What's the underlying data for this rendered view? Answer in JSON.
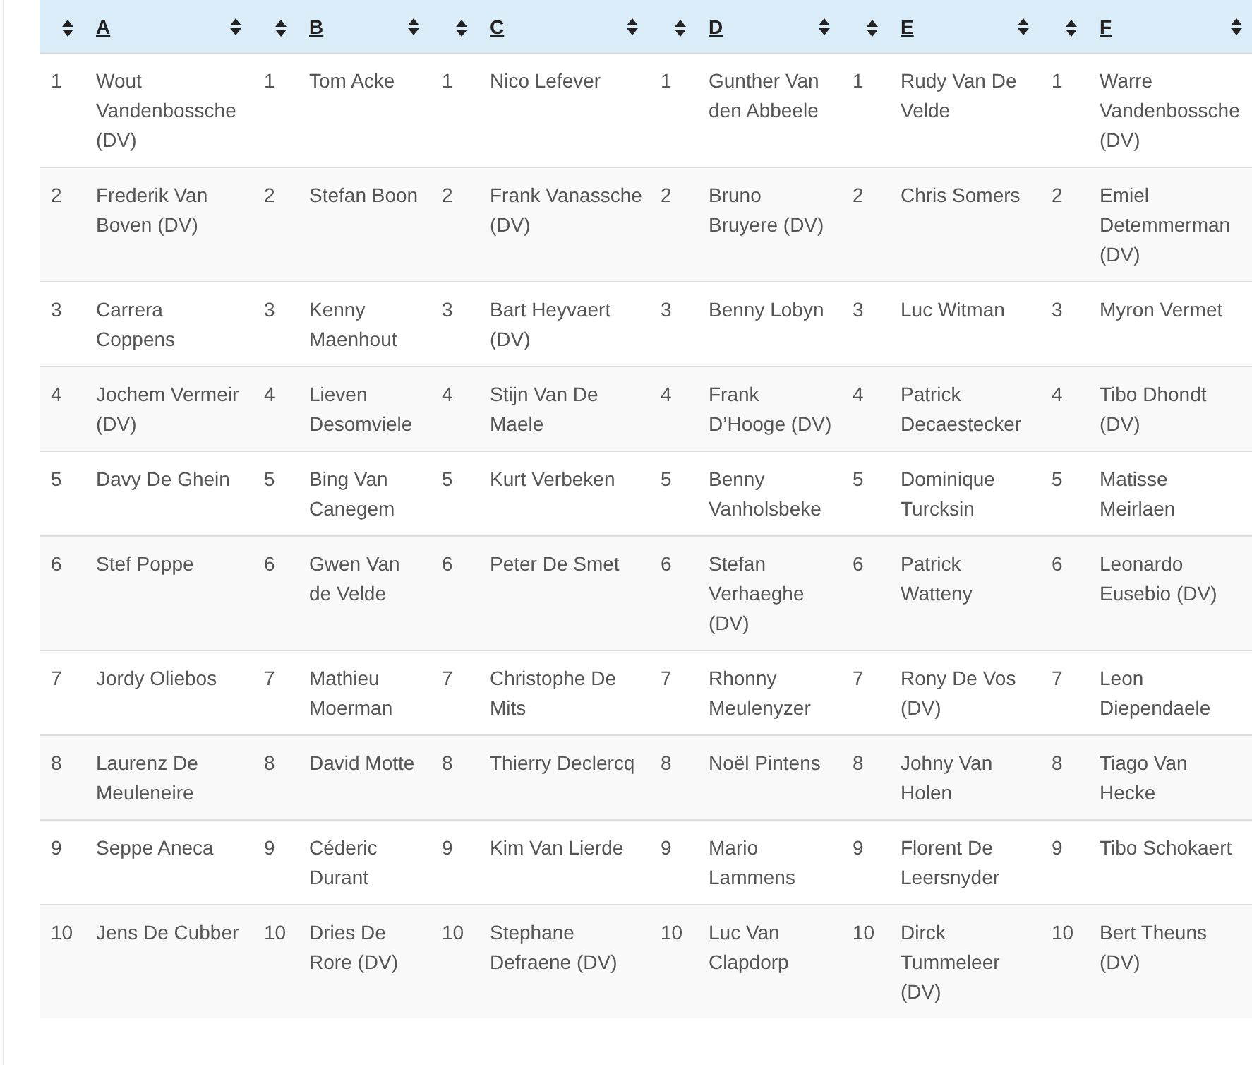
{
  "table": {
    "columns": [
      {
        "label": "A"
      },
      {
        "label": "B"
      },
      {
        "label": "C"
      },
      {
        "label": "D"
      },
      {
        "label": "E"
      },
      {
        "label": "F"
      }
    ],
    "rows": [
      {
        "cells": [
          {
            "number": "1",
            "name": "Wout Vandenbossche (DV)"
          },
          {
            "number": "1",
            "name": "Tom Acke"
          },
          {
            "number": "1",
            "name": "Nico Lefever"
          },
          {
            "number": "1",
            "name": "Gunther Van den Abbeele"
          },
          {
            "number": "1",
            "name": "Rudy Van De Velde"
          },
          {
            "number": "1",
            "name": "Warre Vandenbossche (DV)"
          }
        ]
      },
      {
        "cells": [
          {
            "number": "2",
            "name": "Frederik Van Boven (DV)"
          },
          {
            "number": "2",
            "name": "Stefan Boon"
          },
          {
            "number": "2",
            "name": "Frank Vanassche (DV)"
          },
          {
            "number": "2",
            "name": "Bruno Bruyere (DV)"
          },
          {
            "number": "2",
            "name": "Chris Somers"
          },
          {
            "number": "2",
            "name": "Emiel Detemmerman (DV)"
          }
        ]
      },
      {
        "cells": [
          {
            "number": "3",
            "name": "Carrera Coppens"
          },
          {
            "number": "3",
            "name": "Kenny Maenhout"
          },
          {
            "number": "3",
            "name": "Bart Heyvaert (DV)"
          },
          {
            "number": "3",
            "name": "Benny Lobyn"
          },
          {
            "number": "3",
            "name": "Luc Witman"
          },
          {
            "number": "3",
            "name": "Myron Vermet"
          }
        ]
      },
      {
        "cells": [
          {
            "number": "4",
            "name": "Jochem Vermeir (DV)"
          },
          {
            "number": "4",
            "name": "Lieven Desomviele"
          },
          {
            "number": "4",
            "name": "Stijn Van De Maele"
          },
          {
            "number": "4",
            "name": "Frank D’Hooge (DV)"
          },
          {
            "number": "4",
            "name": "Patrick Decaestecker"
          },
          {
            "number": "4",
            "name": "Tibo Dhondt (DV)"
          }
        ]
      },
      {
        "cells": [
          {
            "number": "5",
            "name": "Davy De Ghein"
          },
          {
            "number": "5",
            "name": "Bing Van Canegem"
          },
          {
            "number": "5",
            "name": "Kurt Verbeken"
          },
          {
            "number": "5",
            "name": "Benny Vanholsbeke"
          },
          {
            "number": "5",
            "name": "Dominique Turcksin"
          },
          {
            "number": "5",
            "name": "Matisse Meirlaen"
          }
        ]
      },
      {
        "cells": [
          {
            "number": "6",
            "name": "Stef Poppe"
          },
          {
            "number": "6",
            "name": "Gwen Van de Velde"
          },
          {
            "number": "6",
            "name": "Peter De Smet"
          },
          {
            "number": "6",
            "name": "Stefan Verhaeghe (DV)"
          },
          {
            "number": "6",
            "name": "Patrick Watteny"
          },
          {
            "number": "6",
            "name": "Leonardo Eusebio (DV)"
          }
        ]
      },
      {
        "cells": [
          {
            "number": "7",
            "name": "Jordy Oliebos"
          },
          {
            "number": "7",
            "name": "Mathieu Moerman"
          },
          {
            "number": "7",
            "name": "Christophe De Mits"
          },
          {
            "number": "7",
            "name": "Rhonny Meulenyzer"
          },
          {
            "number": "7",
            "name": "Rony De Vos (DV)"
          },
          {
            "number": "7",
            "name": "Leon Diependaele"
          }
        ]
      },
      {
        "cells": [
          {
            "number": "8",
            "name": "Laurenz De Meuleneire"
          },
          {
            "number": "8",
            "name": "David Motte"
          },
          {
            "number": "8",
            "name": "Thierry Declercq"
          },
          {
            "number": "8",
            "name": "Noël Pintens"
          },
          {
            "number": "8",
            "name": "Johny Van Holen"
          },
          {
            "number": "8",
            "name": "Tiago Van Hecke"
          }
        ]
      },
      {
        "cells": [
          {
            "number": "9",
            "name": "Seppe Aneca"
          },
          {
            "number": "9",
            "name": "Céderic Durant"
          },
          {
            "number": "9",
            "name": "Kim Van Lierde"
          },
          {
            "number": "9",
            "name": "Mario Lammens"
          },
          {
            "number": "9",
            "name": "Florent De Leersnyder"
          },
          {
            "number": "9",
            "name": "Tibo Schokaert"
          }
        ]
      },
      {
        "cells": [
          {
            "number": "10",
            "name": "Jens De Cubber"
          },
          {
            "number": "10",
            "name": "Dries De Rore (DV)"
          },
          {
            "number": "10",
            "name": "Stephane Defraene (DV)"
          },
          {
            "number": "10",
            "name": "Luc Van Clapdorp"
          },
          {
            "number": "10",
            "name": "Dirck Tummeleer (DV)"
          },
          {
            "number": "10",
            "name": "Bert Theuns (DV)"
          }
        ]
      }
    ]
  }
}
